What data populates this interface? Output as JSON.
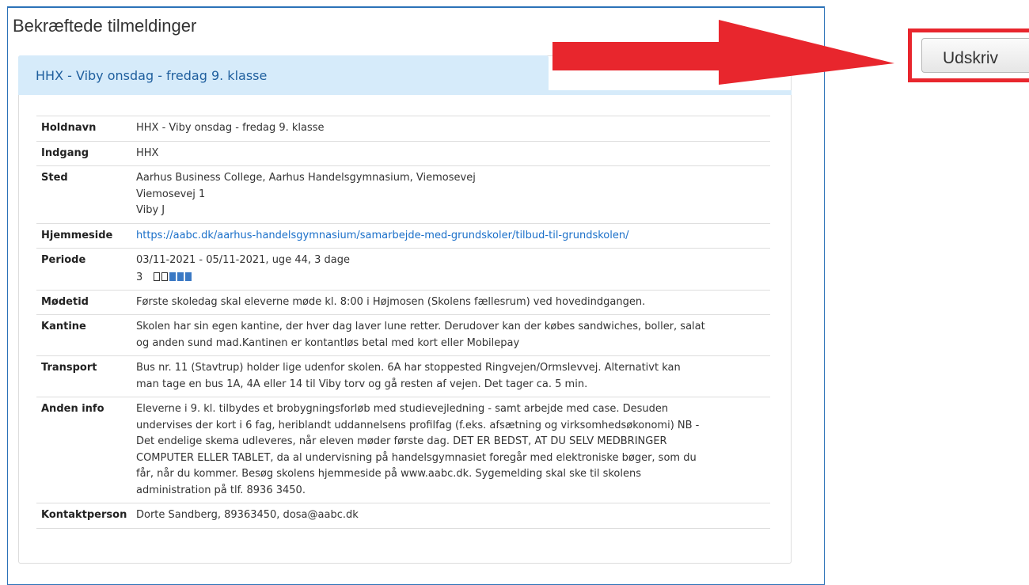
{
  "page_title": "Bekræftede tilmeldinger",
  "card": {
    "header": "HHX - Viby onsdag - fredag 9. klasse",
    "rows": {
      "holdnavn": {
        "label": "Holdnavn",
        "value": "HHX - Viby onsdag - fredag 9. klasse"
      },
      "indgang": {
        "label": "Indgang",
        "value": "HHX"
      },
      "sted": {
        "label": "Sted",
        "line1": "Aarhus Business College, Aarhus Handelsgymnasium, Viemosevej",
        "line2": "Viemosevej 1",
        "line3": "Viby J"
      },
      "hjemmeside": {
        "label": "Hjemmeside",
        "value": "https://aabc.dk/aarhus-handelsgymnasium/samarbejde-med-grundskoler/tilbud-til-grundskolen/"
      },
      "periode": {
        "label": "Periode",
        "value": "03/11-2021 - 05/11-2021, uge 44, 3 dage",
        "count": "3",
        "days_total": 5,
        "days_filled": 3
      },
      "moedetid": {
        "label": "Mødetid",
        "value": "Første skoledag skal eleverne møde kl. 8:00 i Højmosen (Skolens fællesrum) ved hovedindgangen."
      },
      "kantine": {
        "label": "Kantine",
        "line1": "Skolen har sin egen kantine, der hver dag laver lune retter. Derudover kan der købes sandwiches, boller, salat",
        "line2": "og anden sund mad.Kantinen er kontantløs betal med kort eller Mobilepay"
      },
      "transport": {
        "label": "Transport",
        "line1": "Bus nr. 11 (Stavtrup) holder lige udenfor skolen. 6A har stoppested Ringvejen/Ormslevvej. Alternativt kan",
        "line2": "man tage en bus 1A, 4A eller 14 til Viby torv og gå resten af vejen. Det tager ca. 5 min."
      },
      "anden_info": {
        "label": "Anden info",
        "line1": "Eleverne i 9. kl. tilbydes et brobygningsforløb med studievejledning - samt arbejde med case. Desuden",
        "line2": "undervises der kort i 6 fag, heriblandt uddannelsens profilfag (f.eks. afsætning og virksomhedsøkonomi) NB -",
        "line3": "Det endelige skema udleveres, når eleven møder første dag. DET ER BEDST, AT DU SELV MEDBRINGER",
        "line4": "COMPUTER ELLER TABLET, da al undervisning på handelsgymnasiet foregår med elektroniske bøger, som du",
        "line5": "får, når du kommer. Besøg skolens hjemmeside på www.aabc.dk. Sygemelding skal ske til skolens",
        "line6": "administration på tlf. 8936 3450."
      },
      "kontaktperson": {
        "label": "Kontaktperson",
        "value": "Dorte Sandberg, 89363450, dosa@aabc.dk"
      }
    }
  },
  "print_button": {
    "label": "Udskriv"
  },
  "colors": {
    "annotation_red": "#e8262d",
    "panel_border": "#2c72b8",
    "card_header_bg": "#d6ebfa",
    "link": "#1a6fc9"
  }
}
